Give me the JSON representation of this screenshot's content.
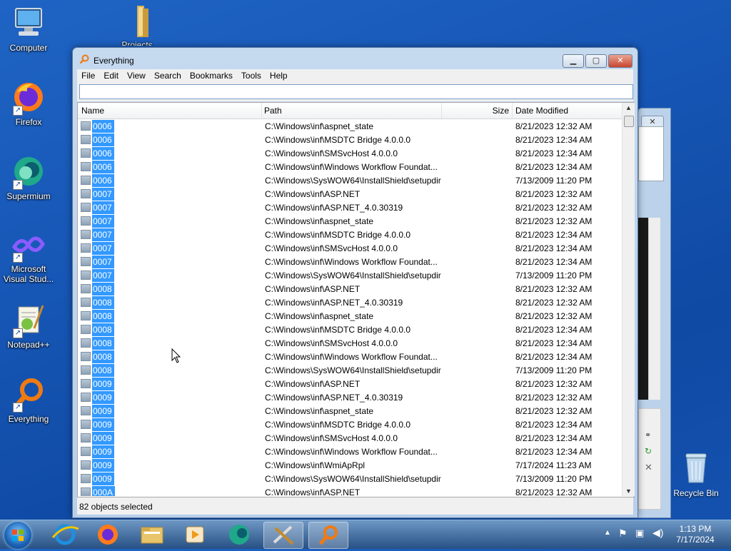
{
  "desktop": {
    "icons": [
      {
        "label": "Computer"
      },
      {
        "label": "Projects"
      },
      {
        "label": "Firefox"
      },
      {
        "label": "Supermium"
      },
      {
        "label": "Microsoft Visual Stud..."
      },
      {
        "label": "Notepad++"
      },
      {
        "label": "Everything"
      },
      {
        "label": "Recycle Bin"
      }
    ]
  },
  "window": {
    "title": "Everything",
    "menu": [
      "File",
      "Edit",
      "View",
      "Search",
      "Bookmarks",
      "Tools",
      "Help"
    ],
    "search_value": "",
    "columns": {
      "name": "Name",
      "path": "Path",
      "size": "Size",
      "modified": "Date Modified"
    },
    "rows": [
      {
        "name": "0006",
        "path": "C:\\Windows\\inf\\aspnet_state",
        "modified": "8/21/2023 12:32 AM"
      },
      {
        "name": "0006",
        "path": "C:\\Windows\\inf\\MSDTC Bridge 4.0.0.0",
        "modified": "8/21/2023 12:34 AM"
      },
      {
        "name": "0006",
        "path": "C:\\Windows\\inf\\SMSvcHost 4.0.0.0",
        "modified": "8/21/2023 12:34 AM"
      },
      {
        "name": "0006",
        "path": "C:\\Windows\\inf\\Windows Workflow Foundat...",
        "modified": "8/21/2023 12:34 AM"
      },
      {
        "name": "0006",
        "path": "C:\\Windows\\SysWOW64\\InstallShield\\setupdir",
        "modified": "7/13/2009 11:20 PM"
      },
      {
        "name": "0007",
        "path": "C:\\Windows\\inf\\ASP.NET",
        "modified": "8/21/2023 12:32 AM"
      },
      {
        "name": "0007",
        "path": "C:\\Windows\\inf\\ASP.NET_4.0.30319",
        "modified": "8/21/2023 12:32 AM"
      },
      {
        "name": "0007",
        "path": "C:\\Windows\\inf\\aspnet_state",
        "modified": "8/21/2023 12:32 AM"
      },
      {
        "name": "0007",
        "path": "C:\\Windows\\inf\\MSDTC Bridge 4.0.0.0",
        "modified": "8/21/2023 12:34 AM"
      },
      {
        "name": "0007",
        "path": "C:\\Windows\\inf\\SMSvcHost 4.0.0.0",
        "modified": "8/21/2023 12:34 AM"
      },
      {
        "name": "0007",
        "path": "C:\\Windows\\inf\\Windows Workflow Foundat...",
        "modified": "8/21/2023 12:34 AM"
      },
      {
        "name": "0007",
        "path": "C:\\Windows\\SysWOW64\\InstallShield\\setupdir",
        "modified": "7/13/2009 11:20 PM"
      },
      {
        "name": "0008",
        "path": "C:\\Windows\\inf\\ASP.NET",
        "modified": "8/21/2023 12:32 AM"
      },
      {
        "name": "0008",
        "path": "C:\\Windows\\inf\\ASP.NET_4.0.30319",
        "modified": "8/21/2023 12:32 AM"
      },
      {
        "name": "0008",
        "path": "C:\\Windows\\inf\\aspnet_state",
        "modified": "8/21/2023 12:32 AM"
      },
      {
        "name": "0008",
        "path": "C:\\Windows\\inf\\MSDTC Bridge 4.0.0.0",
        "modified": "8/21/2023 12:34 AM"
      },
      {
        "name": "0008",
        "path": "C:\\Windows\\inf\\SMSvcHost 4.0.0.0",
        "modified": "8/21/2023 12:34 AM"
      },
      {
        "name": "0008",
        "path": "C:\\Windows\\inf\\Windows Workflow Foundat...",
        "modified": "8/21/2023 12:34 AM"
      },
      {
        "name": "0008",
        "path": "C:\\Windows\\SysWOW64\\InstallShield\\setupdir",
        "modified": "7/13/2009 11:20 PM"
      },
      {
        "name": "0009",
        "path": "C:\\Windows\\inf\\ASP.NET",
        "modified": "8/21/2023 12:32 AM"
      },
      {
        "name": "0009",
        "path": "C:\\Windows\\inf\\ASP.NET_4.0.30319",
        "modified": "8/21/2023 12:32 AM"
      },
      {
        "name": "0009",
        "path": "C:\\Windows\\inf\\aspnet_state",
        "modified": "8/21/2023 12:32 AM"
      },
      {
        "name": "0009",
        "path": "C:\\Windows\\inf\\MSDTC Bridge 4.0.0.0",
        "modified": "8/21/2023 12:34 AM"
      },
      {
        "name": "0009",
        "path": "C:\\Windows\\inf\\SMSvcHost 4.0.0.0",
        "modified": "8/21/2023 12:34 AM"
      },
      {
        "name": "0009",
        "path": "C:\\Windows\\inf\\Windows Workflow Foundat...",
        "modified": "8/21/2023 12:34 AM"
      },
      {
        "name": "0009",
        "path": "C:\\Windows\\inf\\WmiApRpl",
        "modified": "7/17/2024 11:23 AM"
      },
      {
        "name": "0009",
        "path": "C:\\Windows\\SysWOW64\\InstallShield\\setupdir",
        "modified": "7/13/2009 11:20 PM"
      },
      {
        "name": "000A",
        "path": "C:\\Windows\\inf\\ASP.NET",
        "modified": "8/21/2023 12:32 AM"
      }
    ],
    "status": "82 objects selected"
  },
  "background_window": {
    "close_label": "✕"
  },
  "taskbar": {
    "time": "1:13 PM",
    "date": "7/17/2024"
  },
  "colors": {
    "selection": "#3399ff",
    "desktop": "#1757b6"
  }
}
